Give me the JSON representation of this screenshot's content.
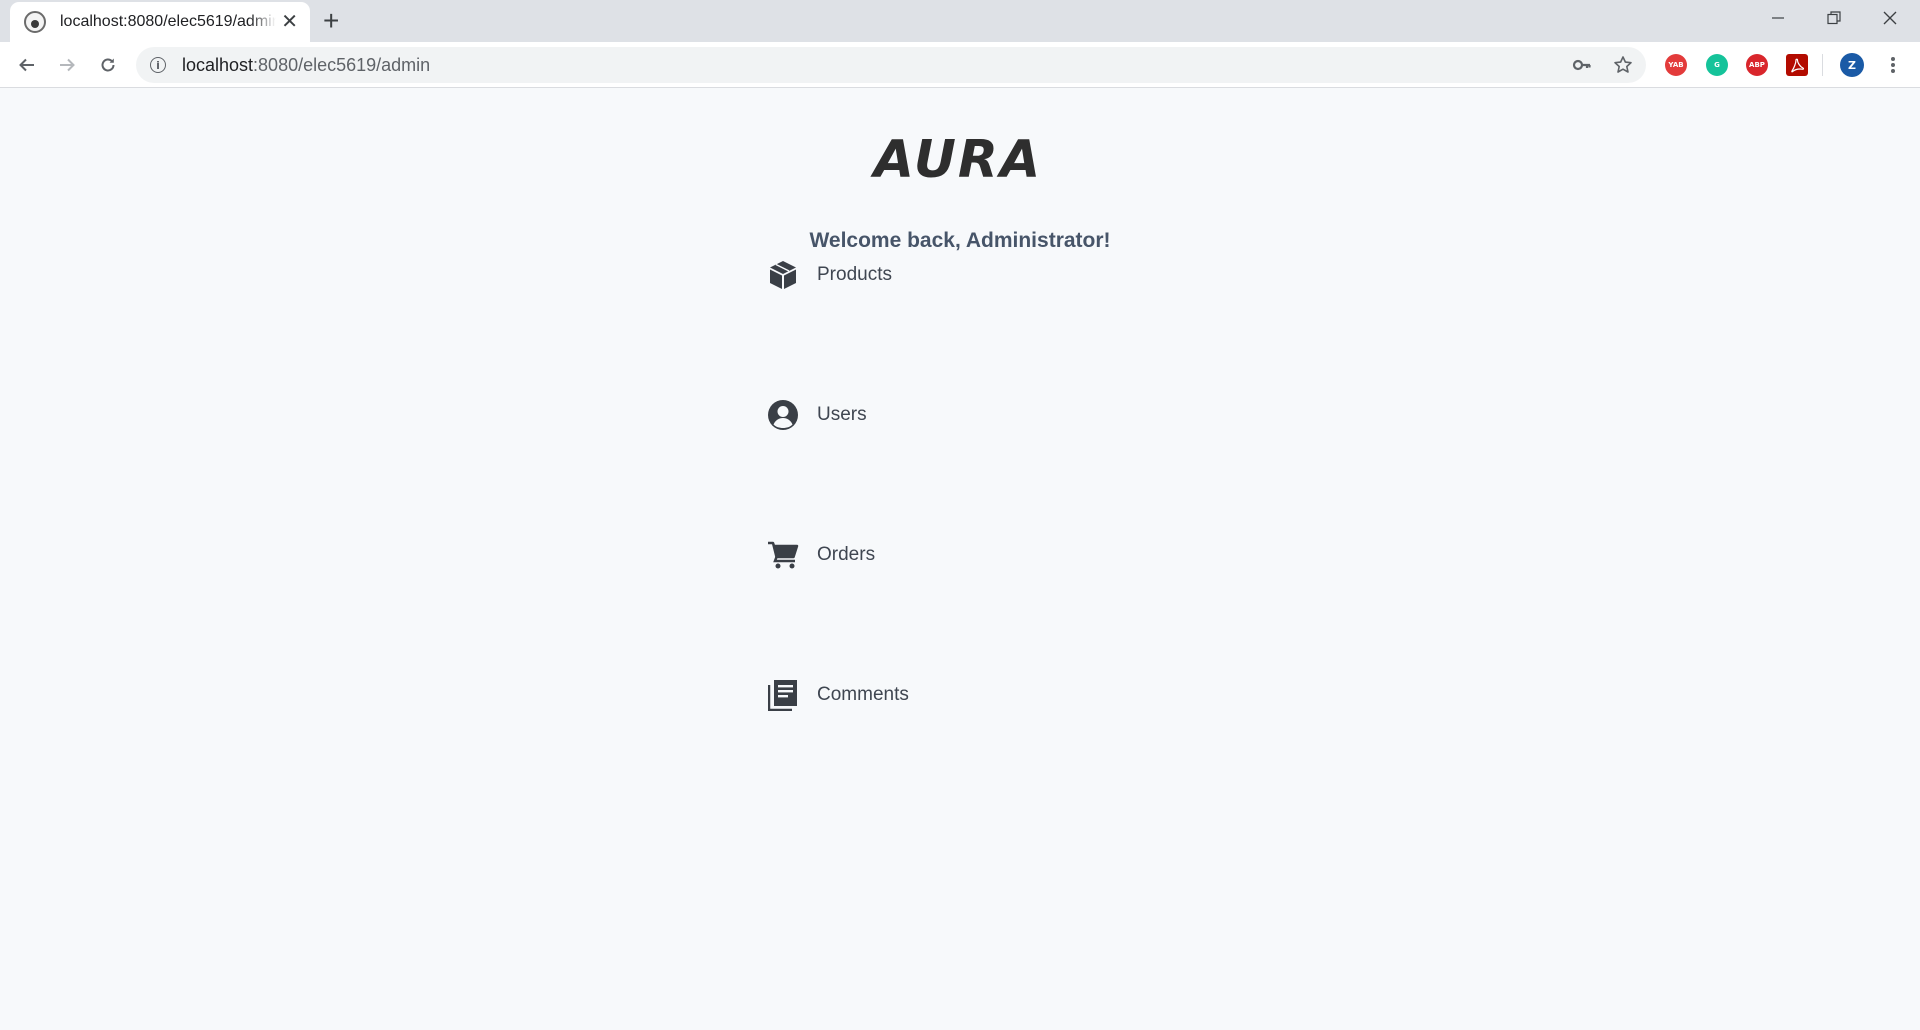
{
  "browser": {
    "tab_title": "localhost:8080/elec5619/admin",
    "url_host": "localhost",
    "url_rest": ":8080/elec5619/admin",
    "profile_initial": "Z",
    "extensions": [
      {
        "name": "yab-extension-icon",
        "label": "YAB",
        "color": "#e33b3b"
      },
      {
        "name": "grammarly-icon",
        "label": "G",
        "color": "#15c39a"
      },
      {
        "name": "adblock-plus-icon",
        "label": "ABP",
        "color": "#d9262c"
      },
      {
        "name": "adobe-acrobat-icon",
        "label": "",
        "color": "#b30b00"
      }
    ]
  },
  "page": {
    "logo_text": "AURA",
    "welcome": "Welcome back, Administrator!",
    "menu": [
      {
        "id": "products",
        "label": "Products",
        "icon": "box-icon"
      },
      {
        "id": "users",
        "label": "Users",
        "icon": "user-circle-icon"
      },
      {
        "id": "orders",
        "label": "Orders",
        "icon": "shopping-cart-icon"
      },
      {
        "id": "comments",
        "label": "Comments",
        "icon": "document-list-icon"
      }
    ]
  }
}
